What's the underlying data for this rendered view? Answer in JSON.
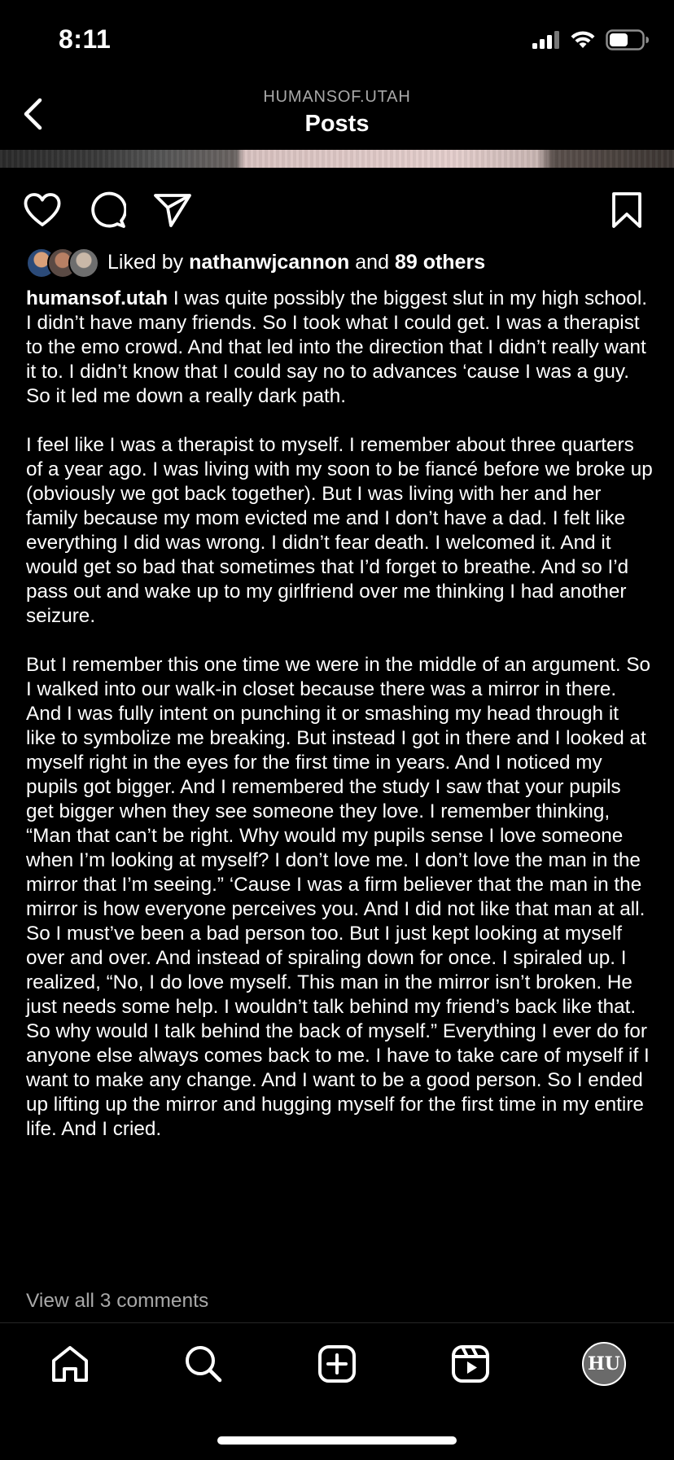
{
  "status_bar": {
    "time": "8:11"
  },
  "header": {
    "subtitle": "HUMANSOF.UTAH",
    "title": "Posts"
  },
  "likes": {
    "prefix": "Liked by",
    "user": "nathanwjcannon",
    "connector": "and",
    "others": "89 others"
  },
  "caption": {
    "username": "humansof.utah",
    "first_paragraph": "I was quite possibly the biggest slut in my high school. I didn’t have many friends. So I took what I could get. I was a therapist to the emo crowd. And that led into the direction that I didn’t really want it to. I didn’t know that I could say no to advances ‘cause I was a guy. So it led me down a really dark path.",
    "second_paragraph": "I feel like I was a therapist to myself. I remember about three quarters of a year ago. I was living with my soon to be fiancé before we broke up (obviously we got back together). But I was living with her and her family because my mom evicted me and I don’t have a dad. I felt like everything I did was wrong. I didn’t fear death. I welcomed it. And it would get so bad that sometimes that I’d forget to breathe. And so I’d pass out and wake up to my girlfriend over me thinking I had another seizure.",
    "third_paragraph": "But I remember this one time we were in the middle of an argument. So I walked into our walk-in closet because there was a mirror in there. And I was fully intent on punching it or smashing my head through it like to symbolize me breaking. But instead I got in there and I looked at myself right in the eyes for the first time in years. And I noticed my pupils got bigger. And I remembered the study I saw that your pupils get bigger when they see someone they love. I remember thinking, “Man that can’t be right. Why would my pupils sense I love someone when I’m looking at myself? I don’t love me. I don’t love the man in the mirror that I’m seeing.” ‘Cause I was a firm believer that the man in the mirror is how everyone perceives you. And I did not like that man at all. So I must’ve been a bad person too. But I just kept looking at myself over and over. And instead of spiraling down for once. I spiraled up. I realized, “No, I do love myself. This man in the mirror isn’t broken. He just needs some help. I wouldn’t talk behind my friend’s back like that. So why would I talk behind the back of myself.” Everything I ever do for anyone else always comes back to me. I have to take care of myself if I want to make any change. And I want to be a good person. So I ended up lifting up the mirror and hugging myself for the first time in my entire life. And I cried."
  },
  "comments": {
    "view_all": "View all 3 comments"
  },
  "tab_bar": {
    "profile_initials": "HU"
  },
  "icons": {
    "back": "chevron-left-icon",
    "like": "heart-icon",
    "comment": "comment-bubble-icon",
    "share": "paper-plane-icon",
    "save": "bookmark-icon",
    "home": "home-icon",
    "search": "search-icon",
    "create": "plus-square-icon",
    "reels": "reels-icon"
  },
  "colors": {
    "background": "#000000",
    "text": "#ffffff",
    "muted": "#a8a8a8"
  }
}
